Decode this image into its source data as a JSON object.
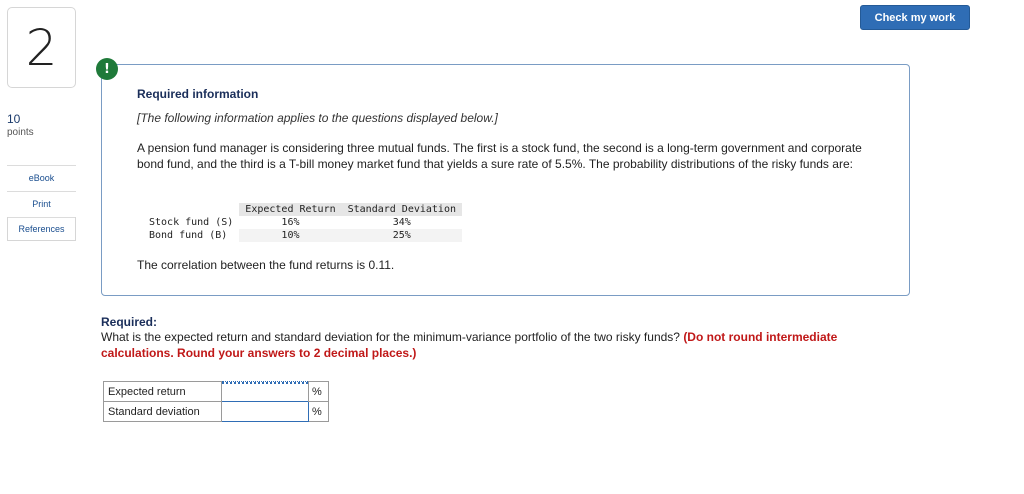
{
  "question": {
    "number": "2",
    "points_value": "10",
    "points_label": "points"
  },
  "sidebar": {
    "ebook": "eBook",
    "print": "Print",
    "references": "References"
  },
  "toolbar": {
    "check_label": "Check my work"
  },
  "alert": {
    "symbol": "!"
  },
  "info": {
    "title": "Required information",
    "note": "[The following information applies to the questions displayed below.]",
    "paragraph": "A pension fund manager is considering three mutual funds. The first is a stock fund, the second is a long-term government and corporate bond fund, and the third is a T-bill money market fund that yields a sure rate of 5.5%. The probability distributions of the risky funds are:",
    "table": {
      "headers": [
        "Expected Return",
        "Standard Deviation"
      ],
      "rows": [
        {
          "name": "Stock fund (S)",
          "expected_return": "16%",
          "std_dev": "34%"
        },
        {
          "name": "Bond fund (B)",
          "expected_return": "10%",
          "std_dev": "25%"
        }
      ]
    },
    "correlation": "The correlation between the fund returns is 0.11."
  },
  "required": {
    "label": "Required:",
    "question": "What is the expected return and standard deviation for the minimum-variance portfolio of the two risky funds?",
    "instruction": "(Do not round intermediate calculations. Round your answers to 2 decimal places.)"
  },
  "answers": [
    {
      "label": "Expected return",
      "value": "",
      "unit": "%"
    },
    {
      "label": "Standard deviation",
      "value": "",
      "unit": "%"
    }
  ],
  "colors": {
    "accent": "#2f6db5",
    "alert_green": "#1f7a3a",
    "warning_red": "#c01818",
    "title_navy": "#1a2e5a"
  }
}
